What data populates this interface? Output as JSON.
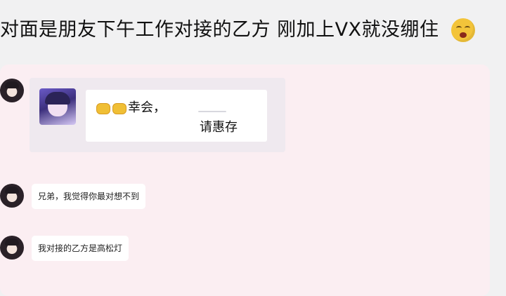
{
  "post": {
    "title": "对面是朋友下午工作对接的乙方 刚加上VX就没绷住",
    "emoji_icon": "astonished-face-emoji"
  },
  "chat": {
    "card": {
      "line1": "幸会，",
      "line2": "请惠存",
      "emoji_icon": "oncoming-fist-emoji"
    },
    "messages": [
      {
        "text": "兄弟，我觉得你最对想不到"
      },
      {
        "text": "我对接的乙方是高松灯"
      }
    ]
  }
}
